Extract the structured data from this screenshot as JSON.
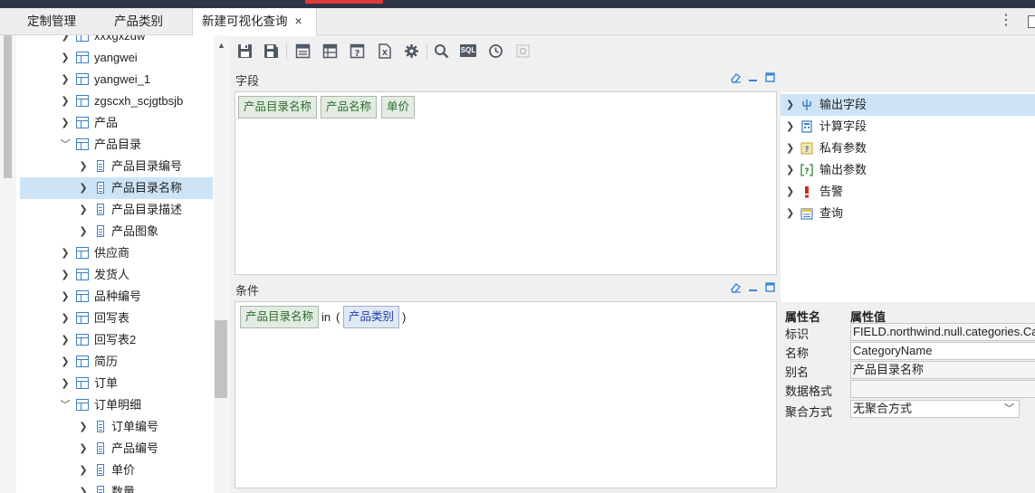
{
  "tabs": {
    "items": [
      {
        "label": "定制管理"
      },
      {
        "label": "产品类别"
      },
      {
        "label": "新建可视化查询"
      }
    ],
    "close_glyph": "×",
    "more_glyph": "⋮"
  },
  "tree": {
    "nodes": [
      {
        "label": "xxxgxzdw",
        "type": "table",
        "expanded": false,
        "indent": 0
      },
      {
        "label": "yangwei",
        "type": "table",
        "expanded": false,
        "indent": 0
      },
      {
        "label": "yangwei_1",
        "type": "table",
        "expanded": false,
        "indent": 0
      },
      {
        "label": "zgscxh_scjgtbsjb",
        "type": "table",
        "expanded": false,
        "indent": 0
      },
      {
        "label": "产品",
        "type": "table",
        "expanded": false,
        "indent": 0
      },
      {
        "label": "产品目录",
        "type": "table",
        "expanded": true,
        "indent": 0
      },
      {
        "label": "产品目录编号",
        "type": "field",
        "indent": 1
      },
      {
        "label": "产品目录名称",
        "type": "field",
        "indent": 1,
        "selected": true
      },
      {
        "label": "产品目录描述",
        "type": "field",
        "indent": 1
      },
      {
        "label": "产品图象",
        "type": "field",
        "indent": 1
      },
      {
        "label": "供应商",
        "type": "table",
        "expanded": false,
        "indent": 0
      },
      {
        "label": "发货人",
        "type": "table",
        "expanded": false,
        "indent": 0
      },
      {
        "label": "品种编号",
        "type": "table",
        "expanded": false,
        "indent": 0
      },
      {
        "label": "回写表",
        "type": "table",
        "expanded": false,
        "indent": 0
      },
      {
        "label": "回写表2",
        "type": "table",
        "expanded": false,
        "indent": 0
      },
      {
        "label": "简历",
        "type": "table",
        "expanded": false,
        "indent": 0
      },
      {
        "label": "订单",
        "type": "table",
        "expanded": false,
        "indent": 0
      },
      {
        "label": "订单明细",
        "type": "table",
        "expanded": true,
        "indent": 0
      },
      {
        "label": "订单编号",
        "type": "field",
        "indent": 1
      },
      {
        "label": "产品编号",
        "type": "field",
        "indent": 1
      },
      {
        "label": "单价",
        "type": "field",
        "indent": 1
      },
      {
        "label": "数量",
        "type": "field",
        "indent": 1
      }
    ]
  },
  "toolbar": {
    "sql_label": "SQL"
  },
  "fields_panel": {
    "title": "字段",
    "chips": [
      "产品目录名称",
      "产品名称",
      "单价"
    ]
  },
  "conditions_panel": {
    "title": "条件",
    "field_chip": "产品目录名称",
    "operator": "in",
    "open_paren": "(",
    "value_chip": "产品类别",
    "close_paren": ")"
  },
  "right_tree": {
    "items": [
      {
        "label": "输出字段",
        "icon": "output-fields-icon",
        "selected": true
      },
      {
        "label": "计算字段",
        "icon": "calc-fields-icon"
      },
      {
        "label": "私有参数",
        "icon": "private-param-icon"
      },
      {
        "label": "输出参数",
        "icon": "output-param-icon"
      },
      {
        "label": "告警",
        "icon": "alarm-icon"
      },
      {
        "label": "查询",
        "icon": "query-icon"
      }
    ]
  },
  "properties": {
    "header_name": "属性名",
    "header_value": "属性值",
    "rows": [
      {
        "name": "标识",
        "value": "FIELD.northwind.null.categories.CategoryName"
      },
      {
        "name": "名称",
        "value": "CategoryName"
      },
      {
        "name": "别名",
        "value": "产品目录名称"
      },
      {
        "name": "数据格式",
        "value": ""
      },
      {
        "name": "聚合方式",
        "value": "无聚合方式"
      }
    ]
  },
  "colors": {
    "topbar": "#2c3646",
    "accent": "#e03a3a",
    "selection": "#cde4f7",
    "chip_green": "#2c6b2c",
    "chip_blue": "#1f3fae",
    "icon_blue": "#3f7fc1"
  }
}
